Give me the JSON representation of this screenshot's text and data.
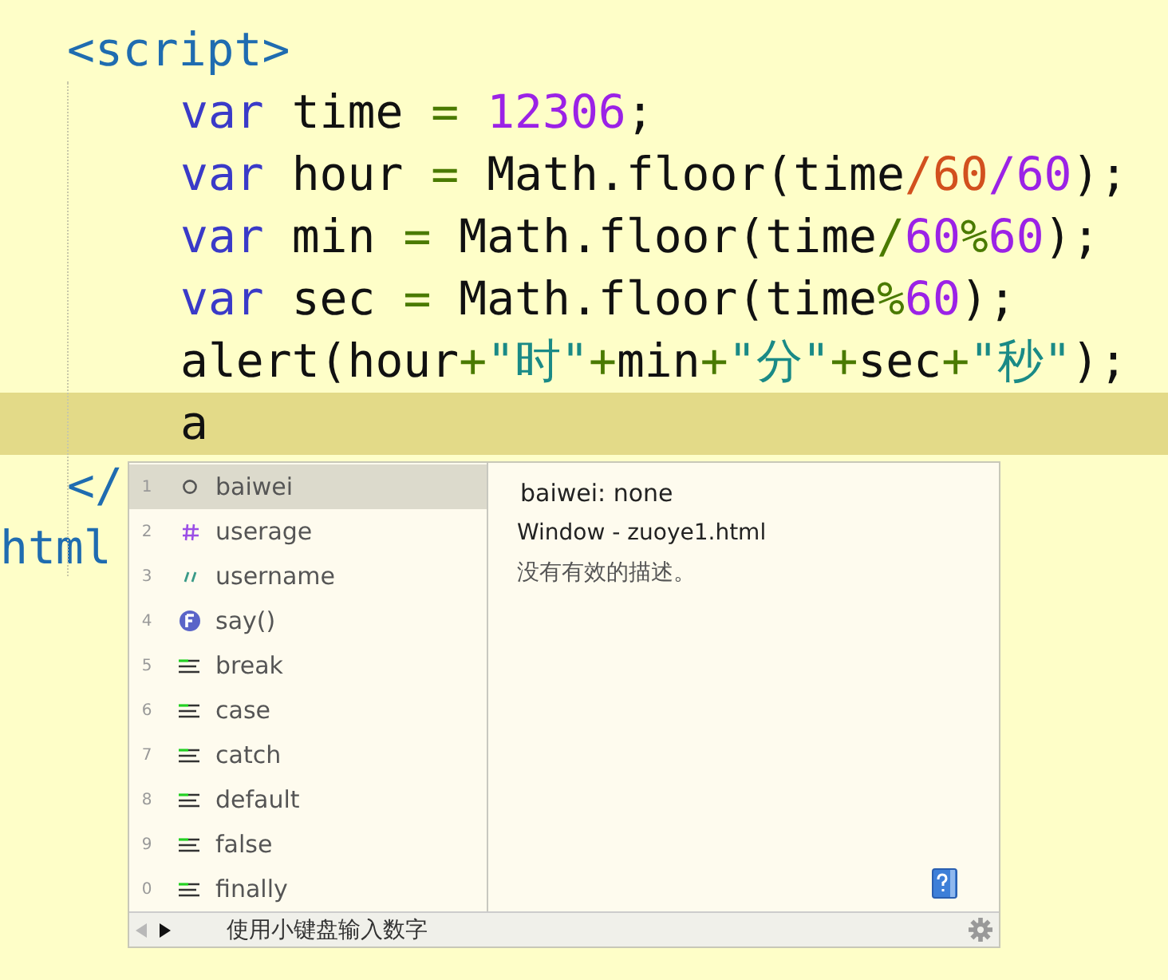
{
  "editor": {
    "lines": [
      {
        "kind": "script-tag",
        "current": false,
        "tokens": [
          {
            "kind": "tag",
            "text": "<script>"
          }
        ]
      },
      {
        "kind": "script-body",
        "current": false,
        "tokens": [
          {
            "kind": "keyword",
            "text": "var "
          },
          {
            "kind": "ident",
            "text": "time "
          },
          {
            "kind": "op",
            "text": "= "
          },
          {
            "kind": "number",
            "text": "12306"
          },
          {
            "kind": "ident",
            "text": ";"
          }
        ]
      },
      {
        "kind": "script-body",
        "current": false,
        "tokens": [
          {
            "kind": "keyword",
            "text": "var "
          },
          {
            "kind": "ident",
            "text": "hour "
          },
          {
            "kind": "op",
            "text": "= "
          },
          {
            "kind": "ident",
            "text": "Math.floor(time"
          },
          {
            "kind": "error",
            "text": "/60"
          },
          {
            "kind": "number",
            "text": "/60"
          },
          {
            "kind": "ident",
            "text": ");"
          }
        ]
      },
      {
        "kind": "script-body",
        "current": false,
        "tokens": [
          {
            "kind": "keyword",
            "text": "var "
          },
          {
            "kind": "ident",
            "text": "min "
          },
          {
            "kind": "op",
            "text": "= "
          },
          {
            "kind": "ident",
            "text": "Math.floor(time"
          },
          {
            "kind": "op",
            "text": "/"
          },
          {
            "kind": "number",
            "text": "60"
          },
          {
            "kind": "op",
            "text": "%"
          },
          {
            "kind": "number",
            "text": "60"
          },
          {
            "kind": "ident",
            "text": ");"
          }
        ]
      },
      {
        "kind": "script-body",
        "current": false,
        "tokens": [
          {
            "kind": "keyword",
            "text": "var "
          },
          {
            "kind": "ident",
            "text": "sec "
          },
          {
            "kind": "op",
            "text": "= "
          },
          {
            "kind": "ident",
            "text": "Math.floor(time"
          },
          {
            "kind": "op",
            "text": "%"
          },
          {
            "kind": "number",
            "text": "60"
          },
          {
            "kind": "ident",
            "text": ");"
          }
        ]
      },
      {
        "kind": "script-body",
        "current": false,
        "tokens": [
          {
            "kind": "ident",
            "text": "alert(hour"
          },
          {
            "kind": "op",
            "text": "+"
          },
          {
            "kind": "string",
            "text": "\"时\""
          },
          {
            "kind": "op",
            "text": "+"
          },
          {
            "kind": "ident",
            "text": "min"
          },
          {
            "kind": "op",
            "text": "+"
          },
          {
            "kind": "string",
            "text": "\"分\""
          },
          {
            "kind": "op",
            "text": "+"
          },
          {
            "kind": "ident",
            "text": "sec"
          },
          {
            "kind": "op",
            "text": "+"
          },
          {
            "kind": "string",
            "text": "\"秒\""
          },
          {
            "kind": "ident",
            "text": ");"
          }
        ]
      },
      {
        "kind": "script-body",
        "current": true,
        "tokens": [
          {
            "kind": "ident",
            "text": "a"
          }
        ]
      },
      {
        "kind": "script-tag",
        "current": false,
        "tokens": [
          {
            "kind": "tag",
            "text": "</"
          }
        ]
      },
      {
        "kind": "document",
        "current": false,
        "tokens": [
          {
            "kind": "tag",
            "text": "html"
          }
        ]
      }
    ]
  },
  "completion": {
    "items": [
      {
        "number": "1",
        "kind": "variable",
        "label": "baiwei",
        "selected": true
      },
      {
        "number": "2",
        "kind": "numeric",
        "label": "userage",
        "selected": false
      },
      {
        "number": "3",
        "kind": "string",
        "label": "username",
        "selected": false
      },
      {
        "number": "4",
        "kind": "function",
        "label": "say()",
        "selected": false
      },
      {
        "number": "5",
        "kind": "keyword",
        "label": "break",
        "selected": false
      },
      {
        "number": "6",
        "kind": "keyword",
        "label": "case",
        "selected": false
      },
      {
        "number": "7",
        "kind": "keyword",
        "label": "catch",
        "selected": false
      },
      {
        "number": "8",
        "kind": "keyword",
        "label": "default",
        "selected": false
      },
      {
        "number": "9",
        "kind": "keyword",
        "label": "false",
        "selected": false
      },
      {
        "number": "0",
        "kind": "keyword",
        "label": "finally",
        "selected": false
      }
    ],
    "detail": {
      "signature": "baiwei: none",
      "source": "Window - zuoye1.html",
      "description": "没有有效的描述。"
    },
    "footer": {
      "hint": "使用小键盘输入数字"
    }
  }
}
